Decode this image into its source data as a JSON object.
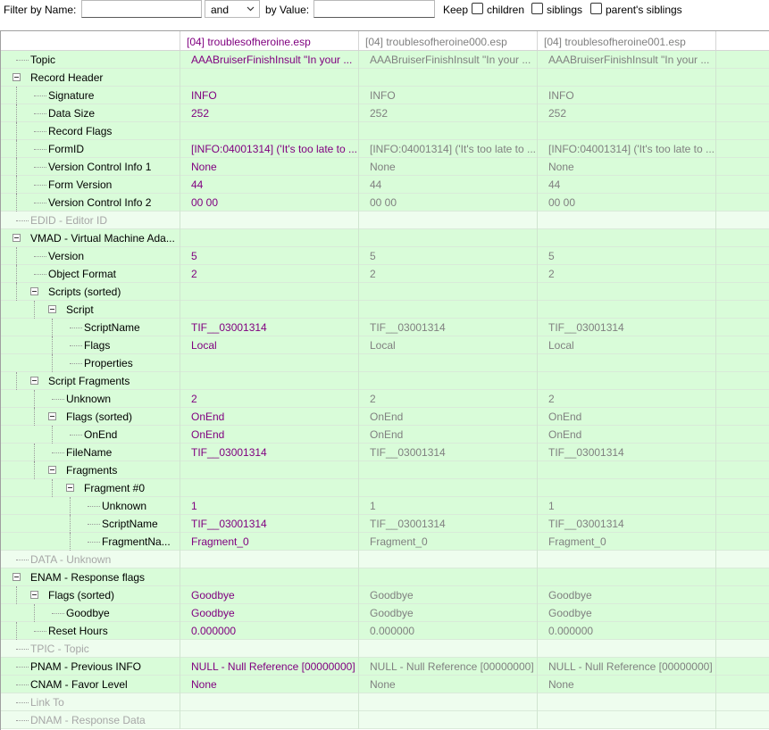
{
  "filter": {
    "name_label": "Filter by Name:",
    "name_value": "",
    "operator": "and",
    "value_label": "by Value:",
    "value_value": "",
    "keep_label": "Keep",
    "children_label": "children",
    "siblings_label": "siblings",
    "parents_siblings_label": "parent's siblings"
  },
  "columns": [
    "[04] troublesofheroine.esp",
    "[04] troublesofheroine000.esp",
    "[04] troublesofheroine001.esp"
  ],
  "colors": {
    "accent_text": "#800080",
    "dim_text": "#808080",
    "row_green": "#d9fcd9",
    "row_empty": "#eefdee",
    "disabled_label": "#a7a7a7"
  },
  "rows": [
    {
      "label": "Topic",
      "v": [
        "AAABruiserFinishInsult \"In your ...",
        "AAABruiserFinishInsult \"In your ...",
        "AAABruiserFinishInsult \"In your ..."
      ]
    },
    {
      "label": "Record Header",
      "v": [
        "",
        "",
        ""
      ]
    },
    {
      "label": "Signature",
      "v": [
        "INFO",
        "INFO",
        "INFO"
      ]
    },
    {
      "label": "Data Size",
      "v": [
        "252",
        "252",
        "252"
      ]
    },
    {
      "label": "Record Flags",
      "v": [
        "",
        "",
        ""
      ]
    },
    {
      "label": "FormID",
      "v": [
        "[INFO:04001314] ('It's too late to ...",
        "[INFO:04001314] ('It's too late to ...",
        "[INFO:04001314] ('It's too late to ..."
      ]
    },
    {
      "label": "Version Control Info 1",
      "v": [
        "None",
        "None",
        "None"
      ]
    },
    {
      "label": "Form Version",
      "v": [
        "44",
        "44",
        "44"
      ]
    },
    {
      "label": "Version Control Info 2",
      "v": [
        "00 00",
        "00 00",
        "00 00"
      ]
    },
    {
      "label": "EDID - Editor ID",
      "v": [
        "",
        "",
        ""
      ]
    },
    {
      "label": "VMAD - Virtual Machine Ada...",
      "v": [
        "",
        "",
        ""
      ]
    },
    {
      "label": "Version",
      "v": [
        "5",
        "5",
        "5"
      ]
    },
    {
      "label": "Object Format",
      "v": [
        "2",
        "2",
        "2"
      ]
    },
    {
      "label": "Scripts (sorted)",
      "v": [
        "",
        "",
        ""
      ]
    },
    {
      "label": "Script",
      "v": [
        "",
        "",
        ""
      ]
    },
    {
      "label": "ScriptName",
      "v": [
        "TIF__03001314",
        "TIF__03001314",
        "TIF__03001314"
      ]
    },
    {
      "label": "Flags",
      "v": [
        "Local",
        "Local",
        "Local"
      ]
    },
    {
      "label": "Properties",
      "v": [
        "",
        "",
        ""
      ]
    },
    {
      "label": "Script Fragments",
      "v": [
        "",
        "",
        ""
      ]
    },
    {
      "label": "Unknown",
      "v": [
        "2",
        "2",
        "2"
      ]
    },
    {
      "label": "Flags (sorted)",
      "v": [
        "OnEnd",
        "OnEnd",
        "OnEnd"
      ]
    },
    {
      "label": "OnEnd",
      "v": [
        "OnEnd",
        "OnEnd",
        "OnEnd"
      ]
    },
    {
      "label": "FileName",
      "v": [
        "TIF__03001314",
        "TIF__03001314",
        "TIF__03001314"
      ]
    },
    {
      "label": "Fragments",
      "v": [
        "",
        "",
        ""
      ]
    },
    {
      "label": "Fragment #0",
      "v": [
        "",
        "",
        ""
      ]
    },
    {
      "label": "Unknown",
      "v": [
        "1",
        "1",
        "1"
      ]
    },
    {
      "label": "ScriptName",
      "v": [
        "TIF__03001314",
        "TIF__03001314",
        "TIF__03001314"
      ]
    },
    {
      "label": "FragmentNa...",
      "v": [
        "Fragment_0",
        "Fragment_0",
        "Fragment_0"
      ]
    },
    {
      "label": "DATA - Unknown",
      "v": [
        "",
        "",
        ""
      ]
    },
    {
      "label": "ENAM - Response flags",
      "v": [
        "",
        "",
        ""
      ]
    },
    {
      "label": "Flags (sorted)",
      "v": [
        "Goodbye",
        "Goodbye",
        "Goodbye"
      ]
    },
    {
      "label": "Goodbye",
      "v": [
        "Goodbye",
        "Goodbye",
        "Goodbye"
      ]
    },
    {
      "label": "Reset Hours",
      "v": [
        "0.000000",
        "0.000000",
        "0.000000"
      ]
    },
    {
      "label": "TPIC - Topic",
      "v": [
        "",
        "",
        ""
      ]
    },
    {
      "label": "PNAM - Previous INFO",
      "v": [
        "NULL - Null Reference [00000000]",
        "NULL - Null Reference [00000000]",
        "NULL - Null Reference [00000000]"
      ]
    },
    {
      "label": "CNAM - Favor Level",
      "v": [
        "None",
        "None",
        "None"
      ]
    },
    {
      "label": "Link To",
      "v": [
        "",
        "",
        ""
      ]
    },
    {
      "label": "DNAM - Response Data",
      "v": [
        "",
        "",
        ""
      ]
    }
  ]
}
